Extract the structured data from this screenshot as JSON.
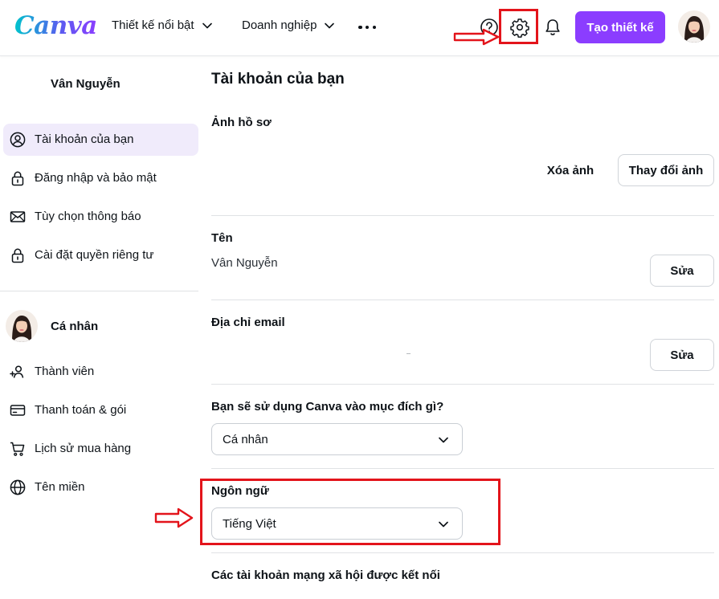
{
  "header": {
    "logo_text": "Canva",
    "nav": [
      {
        "label": "Thiết kế nổi bật"
      },
      {
        "label": "Doanh nghiệp"
      }
    ],
    "create_button": "Tạo thiết kế",
    "icons": [
      "help-icon",
      "gear-icon",
      "bell-icon",
      "more-icon"
    ]
  },
  "sidebar": {
    "user_name": "Vân Nguyễn",
    "account_items": [
      {
        "label": "Tài khoản của bạn",
        "icon": "user-circle-icon",
        "active": true
      },
      {
        "label": "Đăng nhập và bảo mật",
        "icon": "lock-icon"
      },
      {
        "label": "Tùy chọn thông báo",
        "icon": "mail-icon"
      },
      {
        "label": "Cài đặt quyền riêng tư",
        "icon": "lock-icon"
      }
    ],
    "team_name": "Cá nhân",
    "team_items": [
      {
        "label": "Thành viên",
        "icon": "add-person-icon"
      },
      {
        "label": "Thanh toán & gói",
        "icon": "credit-card-icon"
      },
      {
        "label": "Lịch sử mua hàng",
        "icon": "cart-icon"
      },
      {
        "label": "Tên miền",
        "icon": "globe-icon"
      }
    ]
  },
  "main": {
    "title": "Tài khoản của bạn",
    "profile_photo": {
      "label": "Ảnh hồ sơ",
      "remove_label": "Xóa ảnh",
      "change_label": "Thay đổi ảnh"
    },
    "name": {
      "label": "Tên",
      "value": "Vân Nguyễn",
      "edit_label": "Sửa"
    },
    "email": {
      "label": "Địa chỉ email",
      "edit_label": "Sửa"
    },
    "purpose": {
      "label": "Bạn sẽ sử dụng Canva vào mục đích gì?",
      "selected": "Cá nhân"
    },
    "language": {
      "label": "Ngôn ngữ",
      "selected": "Tiếng Việt"
    },
    "social": {
      "label": "Các tài khoản mạng xã hội được kết nối"
    }
  },
  "colors": {
    "brand_purple": "#8b3dff",
    "active_bg": "#f0ebfb",
    "annotation_red": "#e3141b"
  }
}
